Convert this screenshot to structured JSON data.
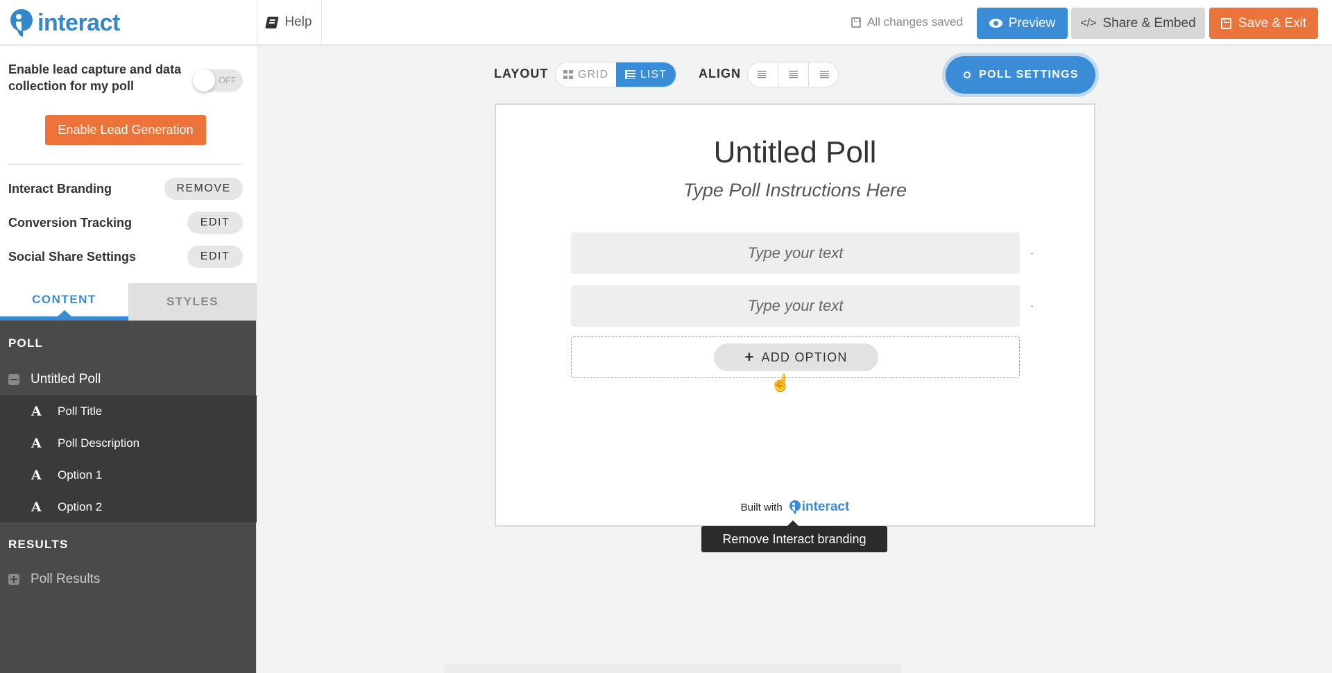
{
  "header": {
    "logo_text": "interact",
    "help_label": "Help",
    "save_status": "All changes saved",
    "preview_label": "Preview",
    "share_label": "Share & Embed",
    "share_icon": "</>",
    "save_exit_label": "Save & Exit"
  },
  "sidebar": {
    "lead_capture_text": "Enable lead capture and data collection for my poll",
    "lead_toggle_state": "OFF",
    "enable_lead_button": "Enable Lead Generation",
    "settings": [
      {
        "label": "Interact Branding",
        "action": "REMOVE"
      },
      {
        "label": "Conversion Tracking",
        "action": "EDIT"
      },
      {
        "label": "Social Share Settings",
        "action": "EDIT"
      }
    ],
    "tabs": [
      {
        "label": "CONTENT",
        "active": true
      },
      {
        "label": "STYLES",
        "active": false
      }
    ],
    "poll_section": {
      "heading": "POLL",
      "parent": "Untitled Poll",
      "children": [
        "Poll Title",
        "Poll Description",
        "Option 1",
        "Option 2"
      ],
      "child_icon": "A"
    },
    "results_section": {
      "heading": "RESULTS",
      "parent": "Poll Results"
    }
  },
  "toolbar": {
    "layout_label": "LAYOUT",
    "layout_options": [
      {
        "label": "GRID",
        "active": false
      },
      {
        "label": "LIST",
        "active": true
      }
    ],
    "align_label": "ALIGN",
    "align_options": [
      "left",
      "center",
      "right"
    ],
    "poll_settings_label": "POLL SETTINGS"
  },
  "poll": {
    "title": "Untitled Poll",
    "instructions": "Type Poll Instructions Here",
    "options": [
      "Type your text",
      "Type your text"
    ],
    "add_option_label": "ADD OPTION",
    "built_with_label": "Built with",
    "built_with_logo": "interact"
  },
  "tooltip": "Remove Interact branding",
  "colors": {
    "brand_blue": "#3a8cd6",
    "accent_orange": "#ec7339",
    "sidebar_dark": "#4a4a4a"
  }
}
